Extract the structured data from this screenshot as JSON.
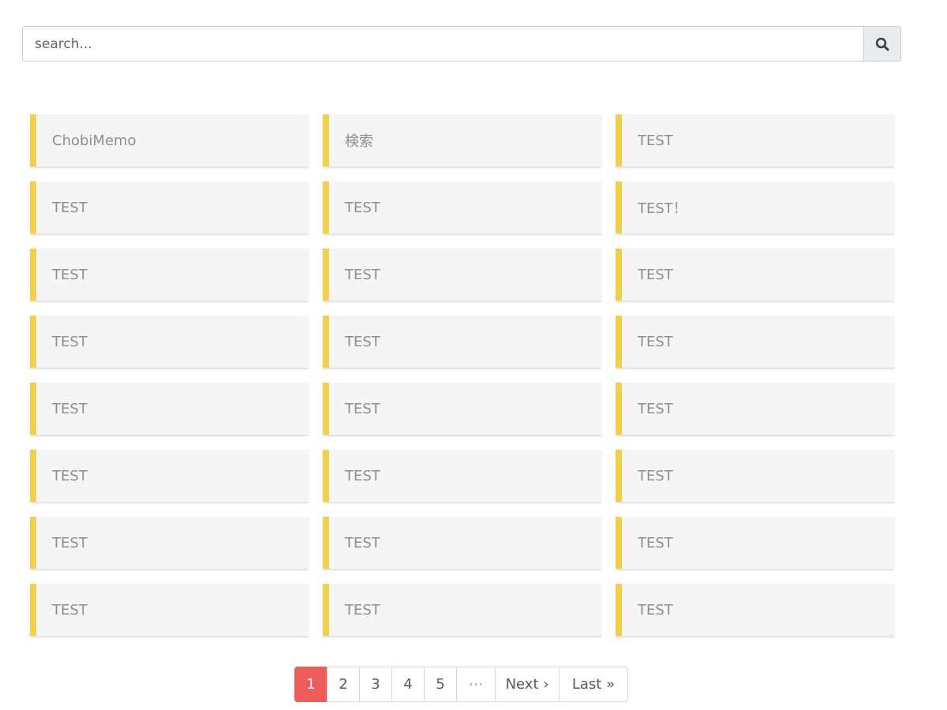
{
  "search": {
    "placeholder": "search...",
    "button_icon": "search-icon"
  },
  "memos": [
    "ChobiMemo",
    "検索",
    "TEST",
    "TEST",
    "TEST",
    "TEST！",
    "TEST",
    "TEST",
    "TEST",
    "TEST",
    "TEST",
    "TEST",
    "TEST",
    "TEST",
    "TEST",
    "TEST",
    "TEST",
    "TEST",
    "TEST",
    "TEST",
    "TEST",
    "TEST",
    "TEST",
    "TEST"
  ],
  "pagination": {
    "pages": [
      "1",
      "2",
      "3",
      "4",
      "5"
    ],
    "current": "1",
    "ellipsis": "⋯",
    "next": "Next ›",
    "last": "Last »"
  },
  "colors": {
    "accent_border": "#f2d04d",
    "active_page": "#ef5a5a",
    "card_background": "#f5f5f5"
  }
}
